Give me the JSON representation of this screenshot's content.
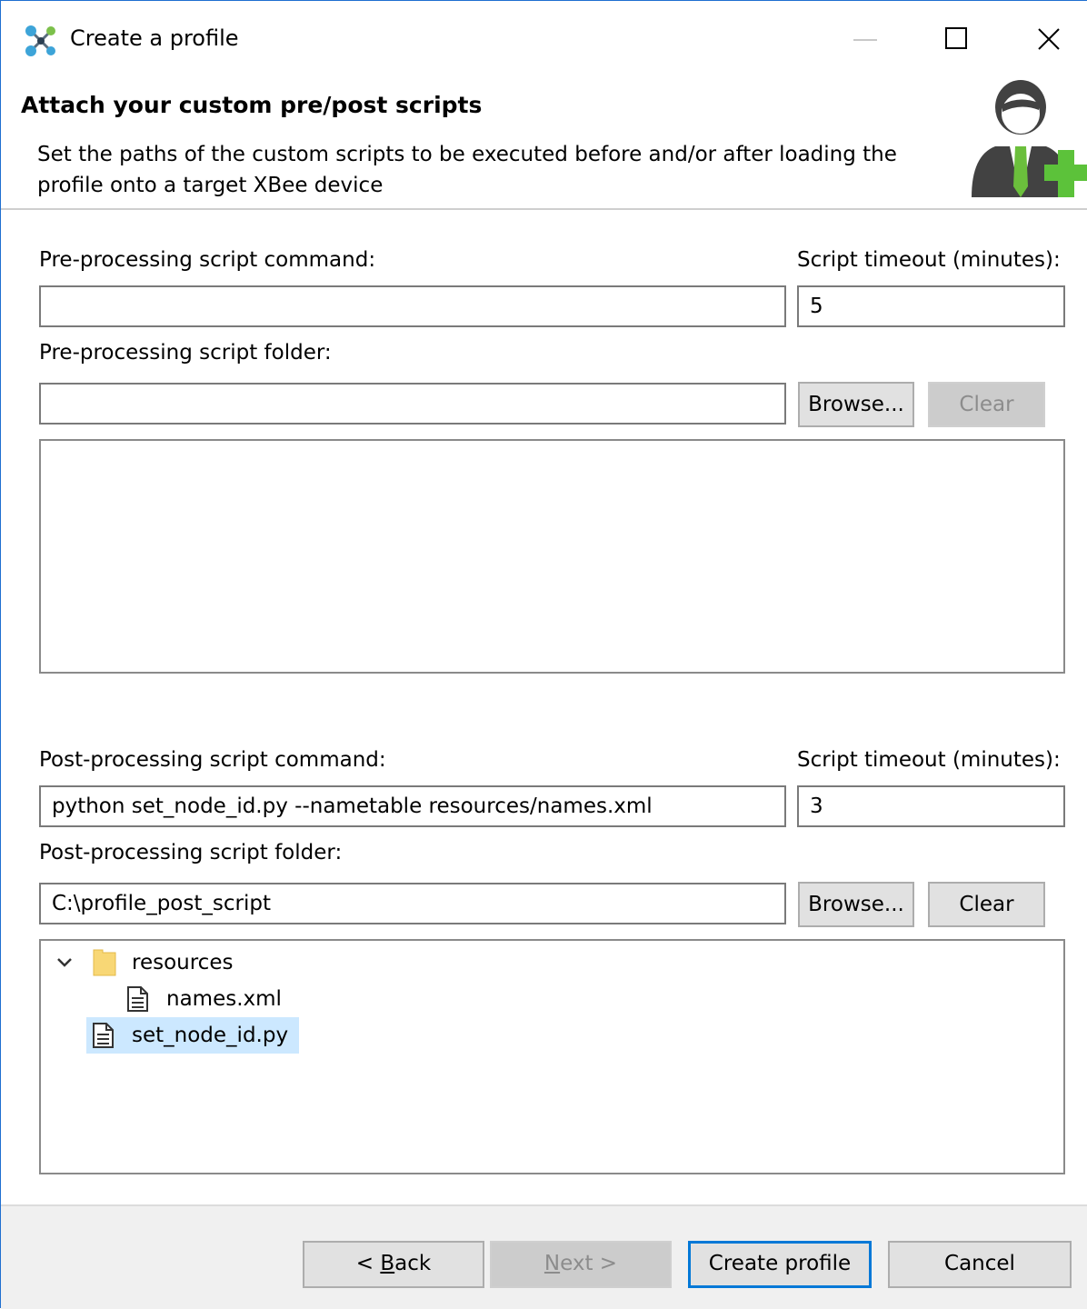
{
  "window": {
    "title": "Create a profile"
  },
  "header": {
    "title": "Attach your custom pre/post scripts",
    "description": "Set the paths of the custom scripts to be executed before and/or after loading the profile onto a target XBee device"
  },
  "pre": {
    "command_label": "Pre-processing script command:",
    "command_value": "",
    "timeout_label": "Script timeout (minutes):",
    "timeout_value": "5",
    "folder_label": "Pre-processing script folder:",
    "folder_value": "",
    "browse_label": "Browse...",
    "clear_label": "Clear"
  },
  "post": {
    "command_label": "Post-processing script command:",
    "command_value": "python set_node_id.py --nametable resources/names.xml",
    "timeout_label": "Script timeout (minutes):",
    "timeout_value": "3",
    "folder_label": "Post-processing script folder:",
    "folder_value": "C:\\profile_post_script",
    "browse_label": "Browse...",
    "clear_label": "Clear",
    "tree": {
      "folder": "resources",
      "child_file": "names.xml",
      "root_file": "set_node_id.py"
    }
  },
  "footer": {
    "back_prefix": "< ",
    "back_mnemonic": "B",
    "back_rest": "ack",
    "next_mnemonic": "N",
    "next_rest": "ext >",
    "create_label": "Create profile",
    "cancel_label": "Cancel"
  },
  "colors": {
    "accent": "#0078d7",
    "selection": "#cce8ff",
    "folder": "#f8d775",
    "plus_green": "#5cc23a"
  }
}
